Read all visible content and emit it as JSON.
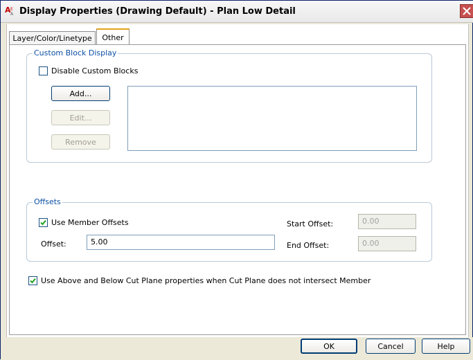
{
  "window": {
    "title": "Display Properties (Drawing Default) - Plan Low Detail",
    "icon": "autocad-architecture-icon",
    "close_icon": "close-icon"
  },
  "tabs": [
    {
      "label": "Layer/Color/Linetype",
      "selected": false
    },
    {
      "label": "Other",
      "selected": true
    }
  ],
  "custom_block_display": {
    "legend": "Custom Block Display",
    "disable_label": "Disable Custom Blocks",
    "disable_checked": false,
    "add_label": "Add...",
    "edit_label": "Edit...",
    "remove_label": "Remove"
  },
  "offsets": {
    "legend": "Offsets",
    "use_member_label": "Use Member Offsets",
    "use_member_checked": true,
    "offset_label": "Offset:",
    "offset_value": "5.00",
    "start_label": "Start Offset:",
    "start_value": "0.00",
    "end_label": "End Offset:",
    "end_value": "0.00"
  },
  "cut_plane": {
    "label": "Use Above and Below Cut Plane properties when Cut Plane does not intersect Member",
    "checked": true
  },
  "footer": {
    "ok_label": "OK",
    "cancel_label": "Cancel",
    "help_label": "Help"
  }
}
